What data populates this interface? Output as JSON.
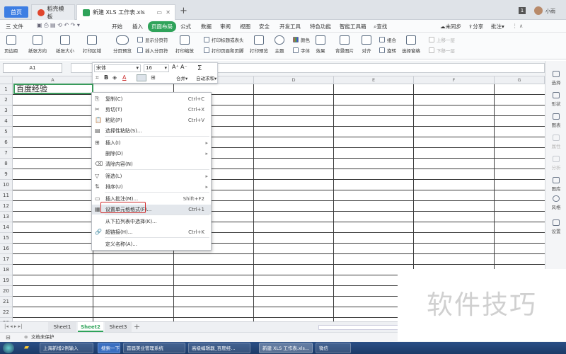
{
  "tabs": {
    "home": "首页",
    "template": "稻壳模板",
    "file": "新建 XLS 工作表.xls",
    "counter": "1",
    "user": "小雨"
  },
  "menu": {
    "file": "三 文件",
    "items": [
      "开始",
      "插入",
      "页面布局",
      "公式",
      "数据",
      "审阅",
      "视图",
      "安全",
      "开发工具",
      "特色功能",
      "智能工具箱"
    ],
    "active": "页面布局",
    "search": "查找",
    "sync": "未同步",
    "share": "分享",
    "comment": "批注"
  },
  "toolbar": {
    "margins": "页边距",
    "orientation": "纸张方向",
    "size": "纸张大小",
    "print_area": "打印区域",
    "page_break_preview": "分页预览",
    "show_breaks": "显示分页符",
    "insert_break": "插入分页符",
    "print_scale": "打印缩放",
    "print_titles": "打印标题或表头",
    "print_header": "打印页眉和页脚",
    "print_preview": "打印预览",
    "theme": "主题",
    "color": "颜色",
    "font": "字体",
    "effect": "效果",
    "background": "背景图片",
    "align": "对齐",
    "rotate": "旋转",
    "group": "组合",
    "select_pane": "选择窗格",
    "up": "上移一层",
    "down": "下移一层"
  },
  "formula": {
    "cell_ref": "A1"
  },
  "mini": {
    "font": "宋体",
    "size": "16",
    "merge": "合并",
    "autosum": "自动求和"
  },
  "grid": {
    "columns": [
      "A",
      "B",
      "C",
      "D",
      "E",
      "F",
      "G"
    ],
    "rows": [
      "1",
      "2",
      "3",
      "4",
      "5",
      "6",
      "7",
      "8",
      "9",
      "10",
      "11",
      "12",
      "13",
      "14",
      "15",
      "16",
      "17",
      "18",
      "19",
      "20",
      "21",
      "22",
      "23"
    ],
    "a1": "百度经验"
  },
  "context_menu": [
    {
      "icon": "copy",
      "label": "复制(C)",
      "shortcut": "Ctrl+C"
    },
    {
      "icon": "cut",
      "label": "剪切(T)",
      "shortcut": "Ctrl+X"
    },
    {
      "icon": "paste",
      "label": "粘贴(P)",
      "shortcut": "Ctrl+V"
    },
    {
      "icon": "paste-special",
      "label": "选择性粘贴(S)...",
      "shortcut": ""
    },
    {
      "icon": "insert",
      "label": "插入(I)",
      "shortcut": ""
    },
    {
      "icon": "delete",
      "label": "删除(D)",
      "shortcut": ""
    },
    {
      "icon": "clear",
      "label": "清除内容(N)",
      "shortcut": ""
    },
    {
      "icon": "filter",
      "label": "筛选(L)",
      "shortcut": ""
    },
    {
      "icon": "sort",
      "label": "排序(U)",
      "shortcut": ""
    },
    {
      "icon": "comment",
      "label": "插入批注(M)...",
      "shortcut": "Shift+F2"
    },
    {
      "icon": "format",
      "label": "设置单元格格式(F)...",
      "shortcut": "Ctrl+1"
    },
    {
      "icon": "",
      "label": "从下拉列表中选择(K)...",
      "shortcut": ""
    },
    {
      "icon": "link",
      "label": "超链接(H)...",
      "shortcut": "Ctrl+K"
    },
    {
      "icon": "",
      "label": "定义名称(A)...",
      "shortcut": ""
    }
  ],
  "sidebar": [
    "选择",
    "形状",
    "图表",
    "属性",
    "分析",
    "图库",
    "风格",
    "设置"
  ],
  "sheets": [
    "Sheet1",
    "Sheet2",
    "Sheet3"
  ],
  "active_sheet": "Sheet2",
  "status": {
    "protect": "文档未保护"
  },
  "taskbar": [
    "上海新增2例输入",
    "搜索一下",
    "首届美业管理系统",
    "高级编辑器_百度经...",
    "新建 XLS 工作表.xls...",
    "微信"
  ],
  "watermark": "软件技巧",
  "colors": {
    "accent": "#3d7ee3",
    "active_tab": "#2fa35a",
    "selection": "#3a9a5c",
    "highlight": "#d13030"
  }
}
